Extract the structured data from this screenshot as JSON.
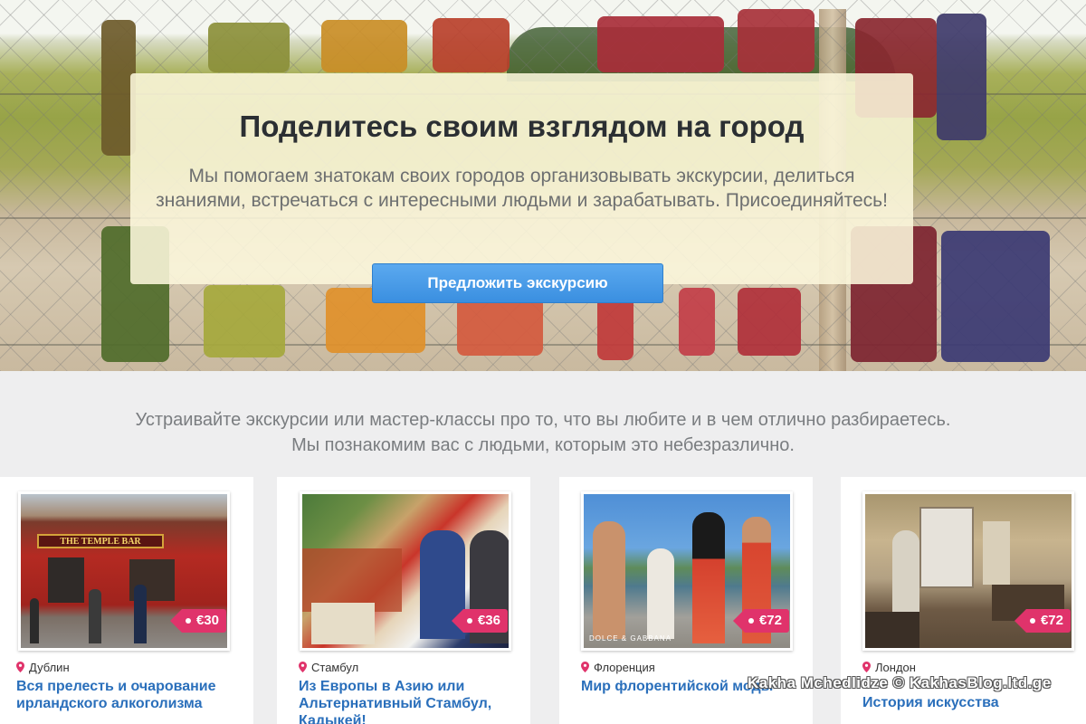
{
  "hero": {
    "title": "Поделитесь своим взглядом на город",
    "text": "Мы помогаем знатокам своих городов организовывать экскурсии, делиться знаниями, встречаться с интересными людьми и зарабатывать. Присоединяйтесь!",
    "cta_label": "Предложить экскурсию"
  },
  "intro": {
    "line1": "Устраивайте экскурсии или мастер-классы про то, что вы любите и в чем отлично разбираетесь.",
    "line2": "Мы познакомим вас с людьми, которым это небезразлично."
  },
  "tours": [
    {
      "city": "Дублин",
      "title": "Вся прелесть и очарование ирландского алкоголизма",
      "price": "€30",
      "photo_sign": "THE TEMPLE BAR"
    },
    {
      "city": "Стамбул",
      "title": "Из Европы в Азию или Альтернативный Стамбул, Кадыкей!",
      "price": "€36"
    },
    {
      "city": "Флоренция",
      "title": "Мир флорентийской моды",
      "price": "€72",
      "photo_sign": "DOLCE & GABBANA"
    },
    {
      "city": "Лондон",
      "title": "История искусства",
      "price": "€72"
    }
  ],
  "watermark": "Kakha Mchedlidze © KakhasBlog.ltd.ge",
  "colors": {
    "accent": "#3a8fe0",
    "price_tag": "#e0336b",
    "link": "#2a6fbb"
  }
}
